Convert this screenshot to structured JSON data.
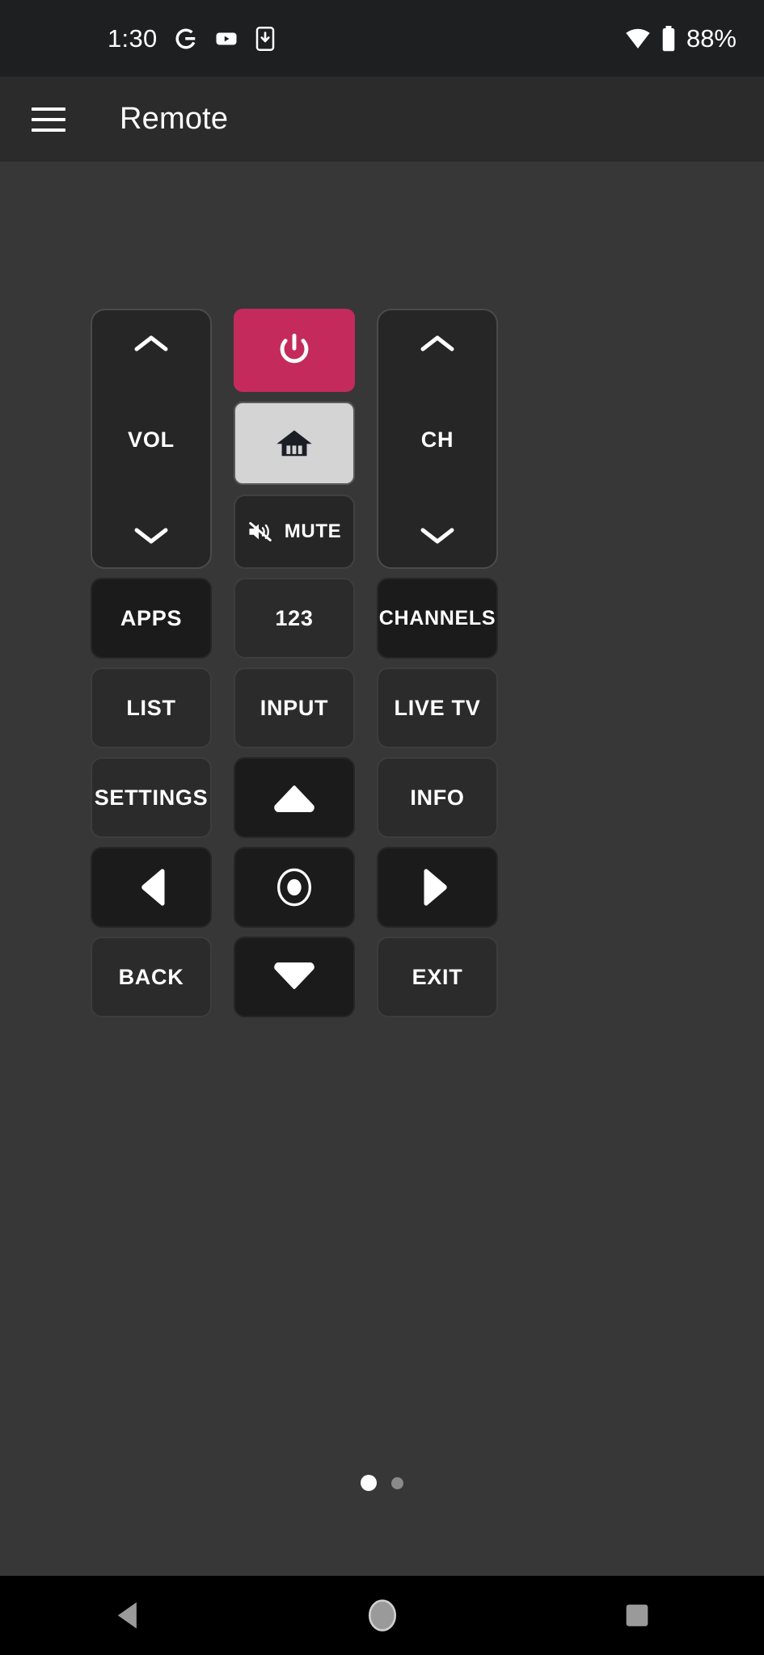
{
  "status_bar": {
    "time": "1:30",
    "battery_percent": "88%",
    "left_icons": [
      "google-g-icon",
      "youtube-icon",
      "phone-download-icon"
    ],
    "right_icons": [
      "wifi-icon",
      "battery-icon"
    ]
  },
  "app_bar": {
    "menu_icon": "hamburger-menu-icon",
    "title": "Remote"
  },
  "colors": {
    "power_accent": "#c42b5c",
    "home_button": "#d4d4d4",
    "page_background": "#373737",
    "button_background": "#2b2b2b",
    "button_background_dark": "#1b1b1b",
    "app_bar": "#2b2b2b",
    "status_bar": "#1d1f21",
    "text": "#ffffff"
  },
  "remote": {
    "volume": {
      "label": "VOL",
      "up_icon": "chevron-up-icon",
      "down_icon": "chevron-down-icon"
    },
    "channel": {
      "label": "CH",
      "up_icon": "chevron-up-icon",
      "down_icon": "chevron-down-icon"
    },
    "power": {
      "icon": "power-icon"
    },
    "home": {
      "icon": "home-icon"
    },
    "mute": {
      "label": "MUTE",
      "icon": "volume-mute-icon"
    },
    "rows": [
      [
        {
          "label": "APPS",
          "style": "dark",
          "icon": null
        },
        {
          "label": "123",
          "style": "normal",
          "icon": null
        },
        {
          "label": "CHANNELS",
          "style": "dark",
          "icon": null
        }
      ],
      [
        {
          "label": "LIST",
          "style": "normal",
          "icon": null
        },
        {
          "label": "INPUT",
          "style": "normal",
          "icon": null
        },
        {
          "label": "LIVE TV",
          "style": "normal",
          "icon": null
        }
      ],
      [
        {
          "label": "SETTINGS",
          "style": "normal",
          "icon": null
        },
        {
          "label": "",
          "style": "dark",
          "icon": "dpad-up-icon"
        },
        {
          "label": "INFO",
          "style": "normal",
          "icon": null
        }
      ],
      [
        {
          "label": "",
          "style": "dark",
          "icon": "dpad-left-icon"
        },
        {
          "label": "",
          "style": "dark",
          "icon": "dpad-ok-icon"
        },
        {
          "label": "",
          "style": "dark",
          "icon": "dpad-right-icon"
        }
      ],
      [
        {
          "label": "BACK",
          "style": "normal",
          "icon": null
        },
        {
          "label": "",
          "style": "dark",
          "icon": "dpad-down-icon"
        },
        {
          "label": "EXIT",
          "style": "normal",
          "icon": null
        }
      ]
    ]
  },
  "pagination": {
    "total": 2,
    "active_index": 0
  },
  "nav_bar": {
    "back": "back-triangle-icon",
    "home": "home-circle-icon",
    "recents": "recents-square-icon"
  }
}
